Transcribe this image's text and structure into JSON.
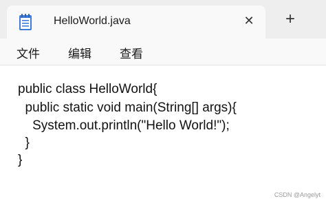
{
  "tab": {
    "title": "HelloWorld.java",
    "close_glyph": "✕",
    "icon": "notepad-icon"
  },
  "new_tab_glyph": "+",
  "menu": {
    "file": "文件",
    "edit": "编辑",
    "view": "查看"
  },
  "editor": {
    "lines": [
      "public class HelloWorld{",
      "  public static void main(String[] args){",
      "    System.out.println(\"Hello World!\");",
      "  }",
      "}"
    ]
  },
  "watermark": "CSDN @Angelyt",
  "colors": {
    "titlebar": "#eeeeee",
    "tab": "#f9f9f9",
    "editor_bg": "#ffffff",
    "notepad_icon": "#3d7bd9"
  }
}
